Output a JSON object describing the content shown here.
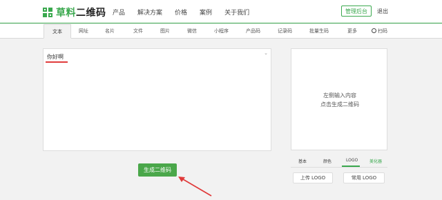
{
  "header": {
    "logo_text_1": "草料",
    "logo_text_2": "二维码",
    "nav": [
      "产品",
      "解决方案",
      "价格",
      "案例",
      "关于我们"
    ],
    "admin_button": "管理后台",
    "logout": "退出"
  },
  "tabs": [
    "文本",
    "网址",
    "名片",
    "文件",
    "图片",
    "微信",
    "小程序",
    "产品码",
    "记录码",
    "批量生码",
    "更多",
    "扫码"
  ],
  "editor": {
    "value": "你好啊",
    "collapse_glyph": "⌄"
  },
  "generate_button": "生成二维码",
  "preview": {
    "line1": "左侧输入内容",
    "line2": "点击生成二维码"
  },
  "sub_tabs": [
    "基本",
    "颜色",
    "LOGO",
    "美化器"
  ],
  "logo_buttons": {
    "upload": "上传 LOGO",
    "common": "常用 LOGO"
  },
  "colors": {
    "brand": "#39a84d",
    "button": "#4aa74a",
    "annotation": "#e03a3a"
  }
}
